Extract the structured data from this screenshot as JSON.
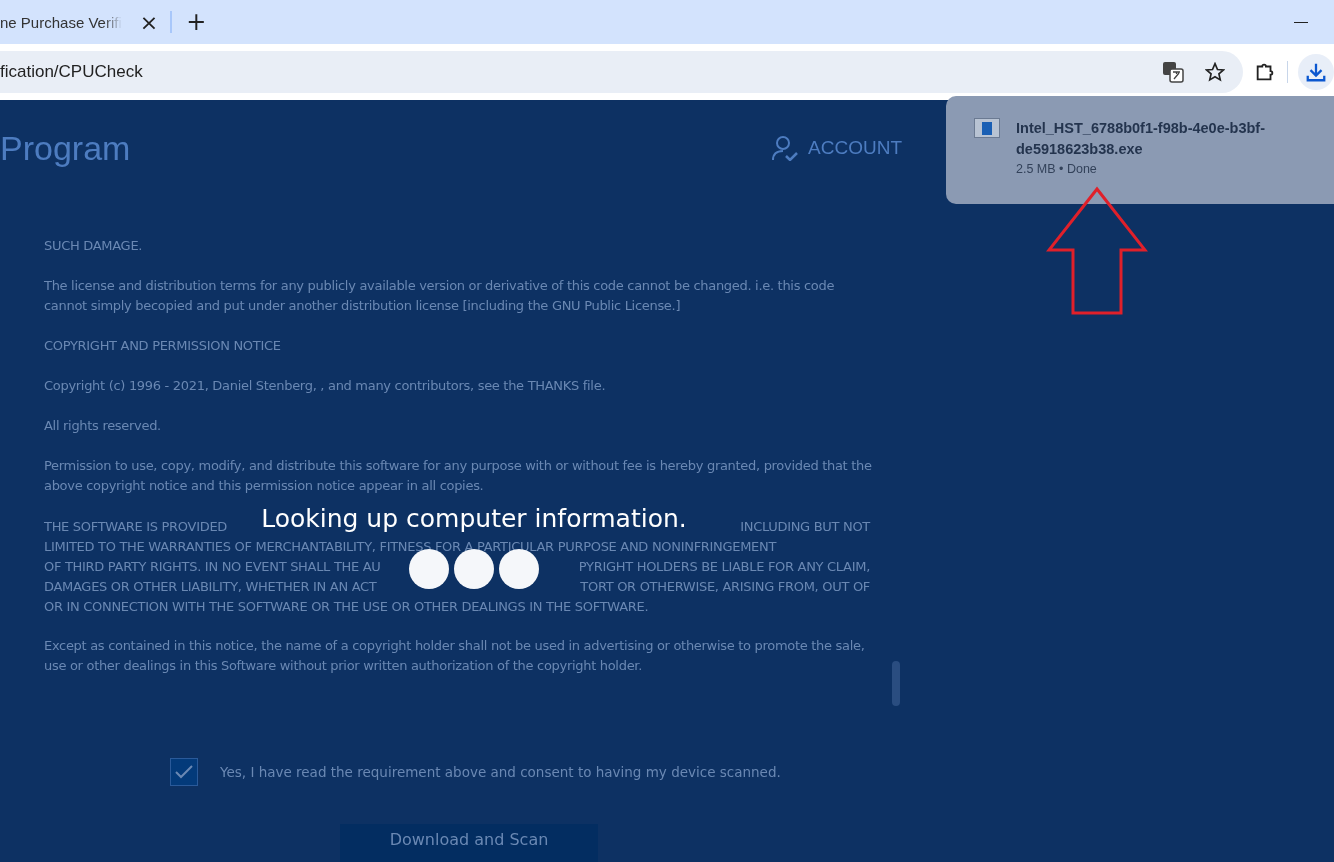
{
  "browser": {
    "tab_title": "ne Purchase Verifi",
    "tab_close": "×",
    "new_tab": "+",
    "url": "fication/CPUCheck"
  },
  "page": {
    "brand": "Program",
    "account": "ACCOUNT",
    "paragraphs": [
      {
        "kind": "text",
        "text": "SUCH DAMAGE."
      },
      {
        "kind": "text",
        "text": "The license and distribution terms for any publicly available version or derivative of this code cannot be changed. i.e. this code cannot simply becopied and put under another distribution license [including the GNU Public License.]"
      },
      {
        "kind": "text",
        "text": "COPYRIGHT AND PERMISSION NOTICE"
      },
      {
        "kind": "text",
        "text": "Copyright (c) 1996 - 2021, Daniel Stenberg, , and many contributors, see the THANKS file."
      },
      {
        "kind": "text",
        "text": "All rights reserved."
      },
      {
        "kind": "text",
        "text": "Permission to use, copy, modify, and distribute this software for any purpose with or without fee is hereby granted, provided that the above copyright notice and this permission notice appear in all copies."
      },
      {
        "kind": "lines",
        "lines": [
          [
            "THE SOFTWARE IS PROVIDED",
            "INCLUDING BUT NOT"
          ],
          [
            "LIMITED TO THE WARRANTIES OF MERCHANTABILITY, FITNESS FOR A PARTICULAR PURPOSE AND NONINFRINGEMENT"
          ],
          [
            "OF THIRD PARTY RIGHTS. IN NO EVENT SHALL THE AU",
            "PYRIGHT HOLDERS BE LIABLE FOR ANY CLAIM,"
          ],
          [
            "DAMAGES OR OTHER LIABILITY, WHETHER IN AN ACT",
            "TORT OR OTHERWISE, ARISING FROM, OUT OF"
          ],
          [
            "OR IN CONNECTION WITH THE SOFTWARE OR THE USE OR OTHER DEALINGS IN THE SOFTWARE."
          ]
        ]
      },
      {
        "kind": "text",
        "text": "Except as contained in this notice, the name of a copyright holder shall not be used in advertising or otherwise to promote the sale, use or other dealings in this Software without prior written authorization of the copyright holder."
      }
    ],
    "consent": {
      "label": "Yes, I have read the requirement above and consent to having my device scanned.",
      "checked": true
    },
    "button": "Download and Scan"
  },
  "loading": {
    "message": "Looking up computer information."
  },
  "download": {
    "filename": "Intel_HST_6788b0f1-f98b-4e0e-b3bf-de5918623b38.exe",
    "status": "2.5 MB • Done"
  }
}
